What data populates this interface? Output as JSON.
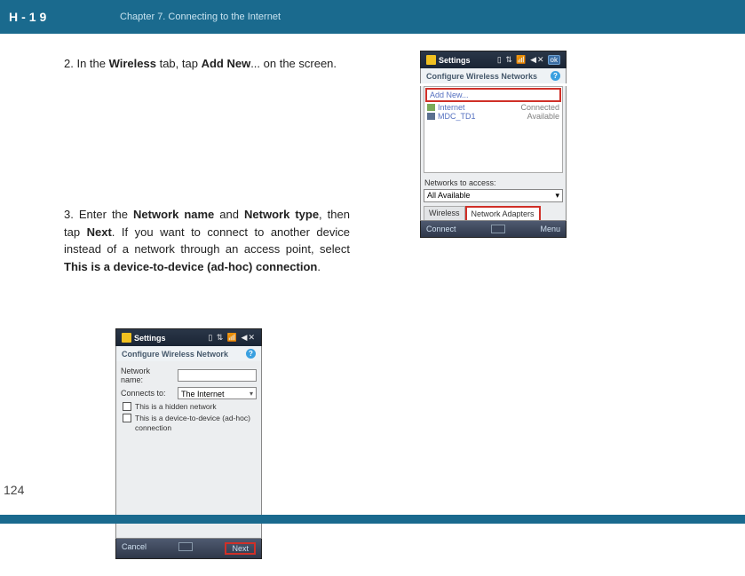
{
  "header": {
    "logo": "H-19",
    "chapter": "Chapter 7. Connecting to the Internet"
  },
  "step2": {
    "num": "2. ",
    "t1": "In the ",
    "b1": "Wireless",
    "t2": " tab, tap ",
    "b2": "Add New",
    "t3": "... on the screen."
  },
  "step3": {
    "num": "3. ",
    "t1": "Enter the ",
    "b1": "Network name",
    "t2": " and ",
    "b2": "Network type",
    "t3": ", then tap ",
    "b3": "Next",
    "t4": ". If you want to connect to another device instead of a network through an access point, select ",
    "b4": "This is a device-to-device (ad-hoc) connection",
    "t5": "."
  },
  "shot1": {
    "title": "Settings",
    "ok": "ok",
    "subhead": "Configure Wireless Networks",
    "add_new": "Add New...",
    "rows": [
      {
        "name": "Internet",
        "status": "Connected"
      },
      {
        "name": "MDC_TD1",
        "status": "Available"
      }
    ],
    "access_label": "Networks to access:",
    "access_value": "All Available",
    "tabs": {
      "wireless": "Wireless",
      "adapters": "Network Adapters"
    },
    "footer": {
      "left": "Connect",
      "right": "Menu"
    }
  },
  "shot2": {
    "title": "Settings",
    "subhead": "Configure Wireless Network",
    "labels": {
      "name": "Network name:",
      "connects": "Connects to:"
    },
    "connects_value": "The Internet",
    "chk1": "This is a hidden network",
    "chk2": "This is a device-to-device (ad-hoc) connection",
    "footer": {
      "cancel": "Cancel",
      "next": "Next"
    }
  },
  "page_number": "124"
}
